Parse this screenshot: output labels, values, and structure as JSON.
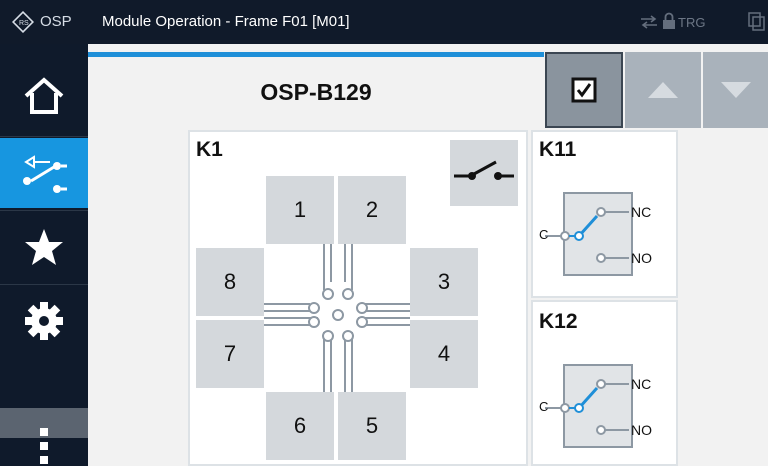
{
  "titlebar": {
    "osp_label": "OSP",
    "title": "Module Operation - Frame F01 [M01]",
    "trg_label": "TRG"
  },
  "sidebar": {
    "items": [
      {
        "name": "home",
        "active": false
      },
      {
        "name": "switch",
        "active": true
      },
      {
        "name": "favorites",
        "active": false
      },
      {
        "name": "settings",
        "active": false
      },
      {
        "name": "more",
        "active": false
      }
    ]
  },
  "header": {
    "module_title": "OSP-B129"
  },
  "k1": {
    "title": "K1",
    "ports": [
      "1",
      "2",
      "3",
      "4",
      "5",
      "6",
      "7",
      "8"
    ]
  },
  "k11": {
    "title": "K11",
    "common": "C",
    "nc": "NC",
    "no": "NO"
  },
  "k12": {
    "title": "K12",
    "common": "C",
    "nc": "NC",
    "no": "NO"
  },
  "colors": {
    "accent": "#1796e0",
    "relay_line": "#1f8fd8",
    "sidebar": "#0f1a2b"
  }
}
